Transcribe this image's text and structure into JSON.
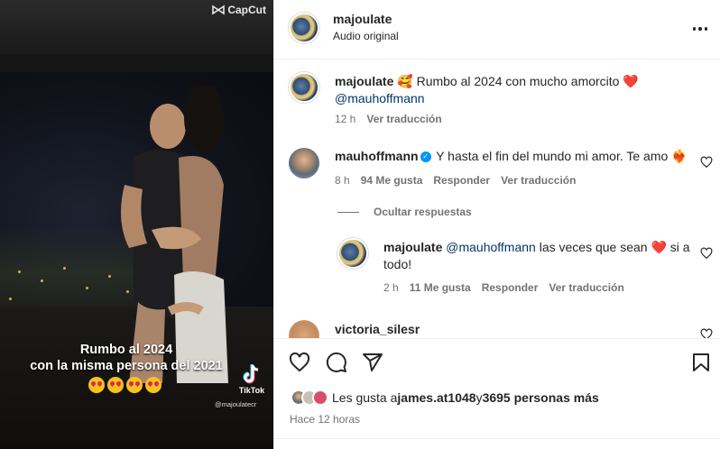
{
  "video": {
    "watermark": "CapCut",
    "caption_line1": "Rumbo al 2024",
    "caption_line2": "con la misma persona del 2021",
    "emojis": "😍😍😍😍",
    "tiktok_label": "TikTok",
    "tiktok_handle": "@majoulatecr"
  },
  "header": {
    "username": "majoulate",
    "audio": "Audio original"
  },
  "caption": {
    "username": "majoulate",
    "emoji": "🥰",
    "text": " Rumbo al 2024 con mucho amorcito ❤️",
    "mention": "@mauhoffmann",
    "time": "12 h",
    "translate": "Ver traducción"
  },
  "comment1": {
    "username": "mauhoffmann",
    "text": "Y hasta el fin del mundo mi amor. Te amo ❤️‍🔥",
    "time": "8 h",
    "likes": "94 Me gusta",
    "reply": "Responder",
    "translate": "Ver traducción"
  },
  "hide_replies": "Ocultar respuestas",
  "reply1": {
    "username": "majoulate",
    "mention": "@mauhoffmann",
    "text_line1": " las veces que sean ❤️ si a",
    "text_line2": "todo!",
    "time": "2 h",
    "likes": "11 Me gusta",
    "reply": "Responder",
    "translate": "Ver traducción"
  },
  "comment2": {
    "username": "victoria_silesr"
  },
  "likes_bar": {
    "prefix": "Les gusta a ",
    "user": "james.at1048",
    "middle": " y ",
    "count": "3695 personas más",
    "time_ago": "Hace 12 horas"
  },
  "colors": {
    "mention": "#00376b",
    "secondary": "#737373",
    "verified": "#0095f6"
  }
}
